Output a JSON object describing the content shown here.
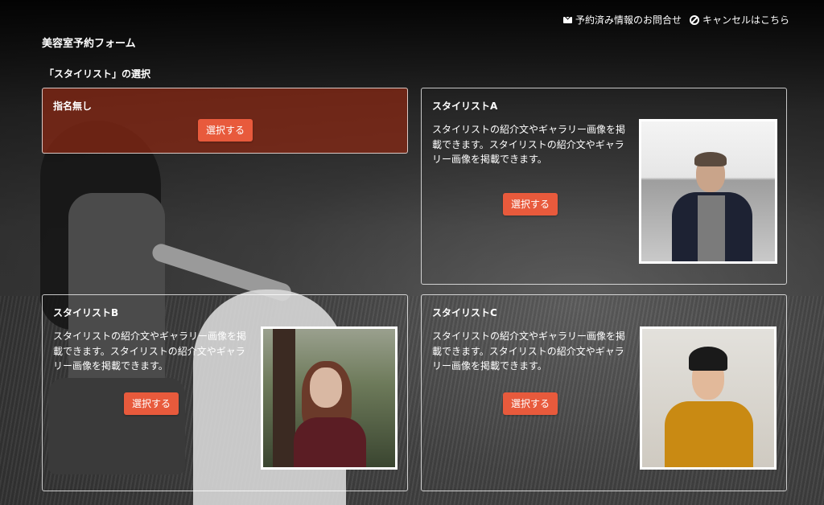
{
  "header": {
    "title": "美容室予約フォーム",
    "links": [
      {
        "label": "予約済み情報のお問合せ",
        "icon": "mail-icon"
      },
      {
        "label": "キャンセルはこちら",
        "icon": "ban-icon"
      }
    ]
  },
  "section": {
    "label": "「スタイリスト」の選択"
  },
  "colors": {
    "accent": "#e85a3c",
    "selected_bg": "#8c2814"
  },
  "stylists": [
    {
      "name": "指名無し",
      "select_label": "選択する",
      "selected": true
    },
    {
      "name": "スタイリストA",
      "description": "スタイリストの紹介文やギャラリー画像を掲載できます。スタイリストの紹介文やギャラリー画像を掲載できます。",
      "select_label": "選択する"
    },
    {
      "name": "スタイリストB",
      "description": "スタイリストの紹介文やギャラリー画像を掲載できます。スタイリストの紹介文やギャラリー画像を掲載できます。",
      "select_label": "選択する"
    },
    {
      "name": "スタイリストC",
      "description": "スタイリストの紹介文やギャラリー画像を掲載できます。スタイリストの紹介文やギャラリー画像を掲載できます。",
      "select_label": "選択する"
    }
  ]
}
